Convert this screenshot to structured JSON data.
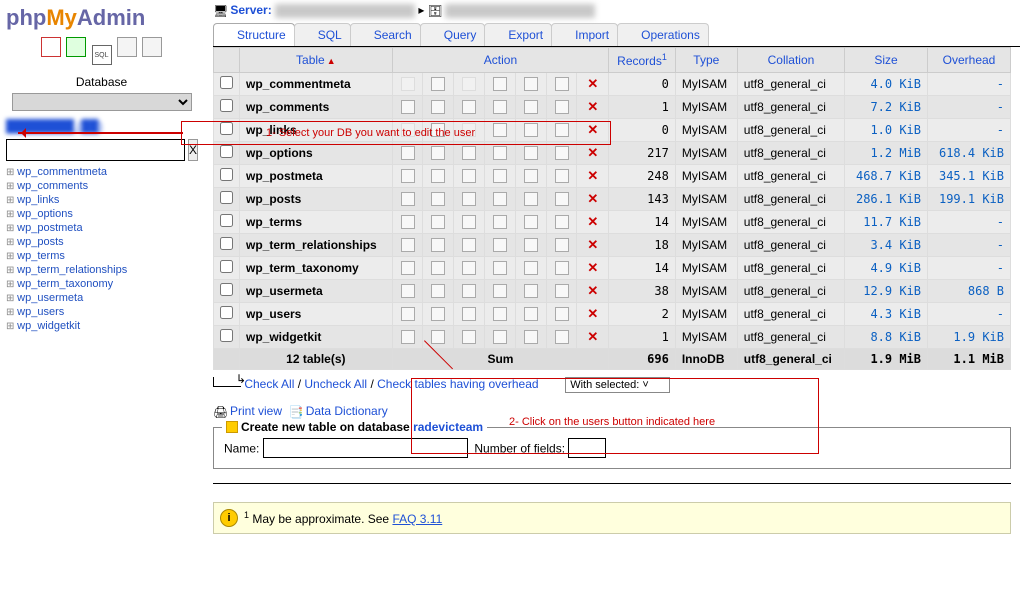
{
  "logo": {
    "p": "php",
    "my": "My",
    "admin": "Admin"
  },
  "sidebar": {
    "database_label": "Database",
    "filter_clear": "X",
    "tree_items": [
      "wp_commentmeta",
      "wp_comments",
      "wp_links",
      "wp_options",
      "wp_postmeta",
      "wp_posts",
      "wp_terms",
      "wp_term_relationships",
      "wp_term_taxonomy",
      "wp_usermeta",
      "wp_users",
      "wp_widgetkit"
    ]
  },
  "server_label": "Server:",
  "tabs": [
    "Structure",
    "SQL",
    "Search",
    "Query",
    "Export",
    "Import",
    "Operations"
  ],
  "table_headers": {
    "table": "Table",
    "action": "Action",
    "records": "Records",
    "records_sup": "1",
    "type": "Type",
    "collation": "Collation",
    "size": "Size",
    "overhead": "Overhead"
  },
  "rows": [
    {
      "name": "wp_commentmeta",
      "dim": true,
      "rec": "0",
      "type": "MyISAM",
      "coll": "utf8_general_ci",
      "size": "4.0 KiB",
      "ov": "-"
    },
    {
      "name": "wp_comments",
      "dim": false,
      "rec": "1",
      "type": "MyISAM",
      "coll": "utf8_general_ci",
      "size": "7.2 KiB",
      "ov": "-"
    },
    {
      "name": "wp_links",
      "dim": true,
      "rec": "0",
      "type": "MyISAM",
      "coll": "utf8_general_ci",
      "size": "1.0 KiB",
      "ov": "-"
    },
    {
      "name": "wp_options",
      "dim": false,
      "rec": "217",
      "type": "MyISAM",
      "coll": "utf8_general_ci",
      "size": "1.2 MiB",
      "ov": "618.4 KiB"
    },
    {
      "name": "wp_postmeta",
      "dim": false,
      "rec": "248",
      "type": "MyISAM",
      "coll": "utf8_general_ci",
      "size": "468.7 KiB",
      "ov": "345.1 KiB"
    },
    {
      "name": "wp_posts",
      "dim": false,
      "rec": "143",
      "type": "MyISAM",
      "coll": "utf8_general_ci",
      "size": "286.1 KiB",
      "ov": "199.1 KiB"
    },
    {
      "name": "wp_terms",
      "dim": false,
      "rec": "14",
      "type": "MyISAM",
      "coll": "utf8_general_ci",
      "size": "11.7 KiB",
      "ov": "-"
    },
    {
      "name": "wp_term_relationships",
      "dim": false,
      "rec": "18",
      "type": "MyISAM",
      "coll": "utf8_general_ci",
      "size": "3.4 KiB",
      "ov": "-"
    },
    {
      "name": "wp_term_taxonomy",
      "dim": false,
      "rec": "14",
      "type": "MyISAM",
      "coll": "utf8_general_ci",
      "size": "4.9 KiB",
      "ov": "-"
    },
    {
      "name": "wp_usermeta",
      "dim": false,
      "rec": "38",
      "type": "MyISAM",
      "coll": "utf8_general_ci",
      "size": "12.9 KiB",
      "ov": "868 B"
    },
    {
      "name": "wp_users",
      "dim": false,
      "rec": "2",
      "type": "MyISAM",
      "coll": "utf8_general_ci",
      "size": "4.3 KiB",
      "ov": "-"
    },
    {
      "name": "wp_widgetkit",
      "dim": false,
      "rec": "1",
      "type": "MyISAM",
      "coll": "utf8_general_ci",
      "size": "8.8 KiB",
      "ov": "1.9 KiB"
    }
  ],
  "total": {
    "label": "12 table(s)",
    "sum": "Sum",
    "rec": "696",
    "type": "InnoDB",
    "coll": "utf8_general_ci",
    "size": "1.9 MiB",
    "ov": "1.1 MiB"
  },
  "below": {
    "check_all": "Check All",
    "uncheck_all": "Uncheck All",
    "check_overhead": "Check tables having overhead",
    "sep": " / ",
    "with_selected": "With selected:",
    "print_view": "Print view",
    "data_dict": "Data Dictionary"
  },
  "create": {
    "legend_a": "Create new table on database ",
    "db": "radevicteam",
    "name_lbl": "Name:",
    "fields_lbl": "Number of fields:"
  },
  "note": {
    "sup": "1",
    "text": " May be approximate. See ",
    "link": "FAQ 3.11"
  },
  "anno": {
    "t1": "1- Select your DB you want to edit the user",
    "t2": "2- Click on the users button indicated here"
  }
}
